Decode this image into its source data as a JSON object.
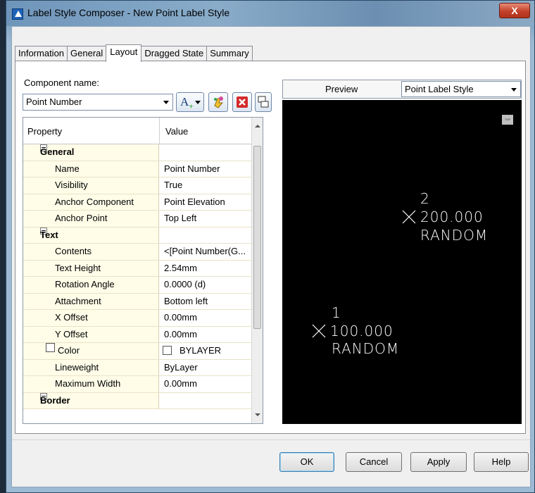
{
  "window": {
    "title": "Label Style Composer - New Point Label Style",
    "close_label": "X"
  },
  "tabs": [
    {
      "label": "Information"
    },
    {
      "label": "General"
    },
    {
      "label": "Layout",
      "active": true
    },
    {
      "label": "Dragged State"
    },
    {
      "label": "Summary"
    }
  ],
  "component": {
    "label": "Component name:",
    "selected": "Point Number"
  },
  "toolbar": {
    "text_component_label": "A"
  },
  "grid": {
    "headers": {
      "property": "Property",
      "value": "Value"
    },
    "rows": [
      {
        "type": "category",
        "name": "General"
      },
      {
        "type": "item",
        "name": "Name",
        "value": "Point Number"
      },
      {
        "type": "item",
        "name": "Visibility",
        "value": "True"
      },
      {
        "type": "item",
        "name": "Anchor Component",
        "value": "Point Elevation"
      },
      {
        "type": "item",
        "name": "Anchor Point",
        "value": "Top Left"
      },
      {
        "type": "category",
        "name": "Text"
      },
      {
        "type": "item",
        "name": "Contents",
        "value": "<[Point Number(G..."
      },
      {
        "type": "item",
        "name": "Text Height",
        "value": "2.54mm"
      },
      {
        "type": "item",
        "name": "Rotation Angle",
        "value": "0.0000 (d)"
      },
      {
        "type": "item",
        "name": "Attachment",
        "value": "Bottom left"
      },
      {
        "type": "item",
        "name": "X Offset",
        "value": "0.00mm"
      },
      {
        "type": "item",
        "name": "Y Offset",
        "value": "0.00mm"
      },
      {
        "type": "item",
        "name": "Color",
        "value": "BYLAYER",
        "checkbox": true
      },
      {
        "type": "item",
        "name": "Lineweight",
        "value": "ByLayer"
      },
      {
        "type": "item",
        "name": "Maximum Width",
        "value": "0.00mm"
      },
      {
        "type": "category",
        "name": "Border"
      }
    ]
  },
  "preview": {
    "label": "Preview",
    "style_selected": "Point Label Style",
    "view_cube_label": "TOP",
    "points": [
      {
        "number": "2",
        "elevation": "200.000",
        "description": "RANDOM"
      },
      {
        "number": "1",
        "elevation": "100.000",
        "description": "RANDOM"
      }
    ]
  },
  "buttons": {
    "ok": "OK",
    "cancel": "Cancel",
    "apply": "Apply",
    "help": "Help"
  }
}
